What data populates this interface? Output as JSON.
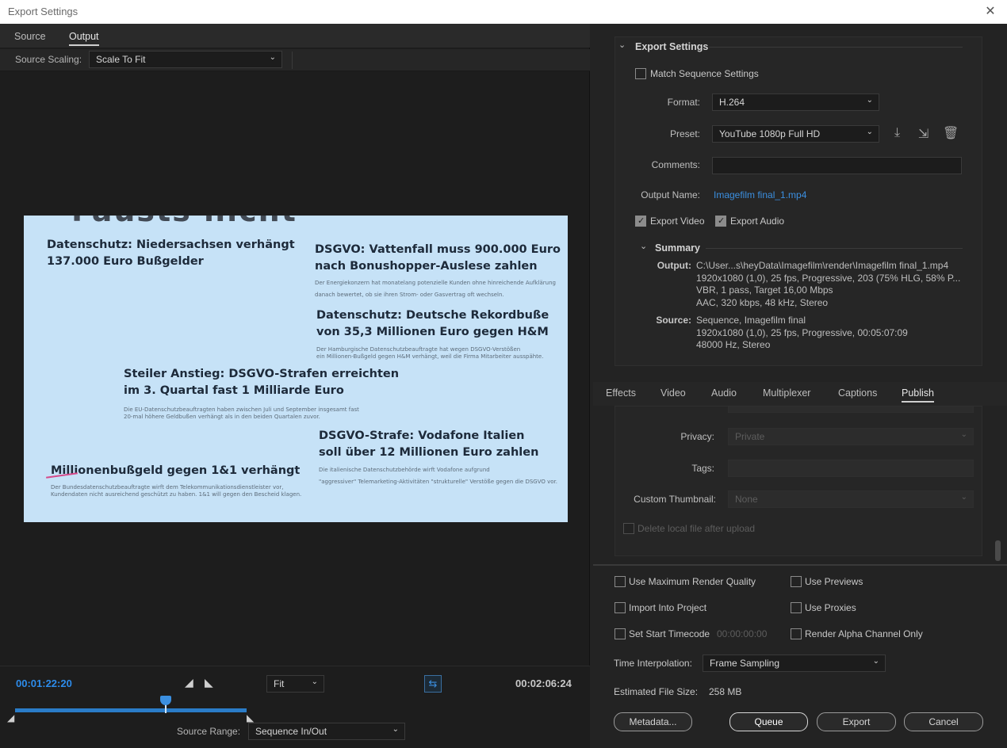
{
  "window": {
    "title": "Export Settings",
    "close_glyph": "✕"
  },
  "left": {
    "tabs": [
      "Source",
      "Output"
    ],
    "active_tab": "Output",
    "source_scaling_label": "Source Scaling:",
    "source_scaling_value": "Scale To Fit",
    "preview": {
      "faint_top_text": "Fausts nicht",
      "articles": [
        {
          "headline_1": "Datenschutz: Niedersachsen verhängt",
          "headline_2": "137.000 Euro Bußgelder",
          "body_1": "",
          "body_2": ""
        },
        {
          "headline_1": "DSGVO: Vattenfall muss 900.000 Euro",
          "headline_2": "nach Bonushopper-Auslese zahlen",
          "body_1": "Der Energiekonzern hat monatelang potenzielle Kunden ohne hinreichende Aufklärung",
          "body_2": "danach bewertet, ob sie ihren Strom- oder Gasvertrag oft wechseln."
        },
        {
          "headline_1": "Datenschutz: Deutsche Rekordbuße",
          "headline_2": "von 35,3 Millionen Euro gegen H&M",
          "body_1": "Der Hamburgische Datenschutzbeauftragte hat wegen DSGVO-Verstößen",
          "body_2": "ein Millionen-Bußgeld gegen H&M verhängt, weil die Firma Mitarbeiter ausspähte."
        },
        {
          "headline_1": "Steiler Anstieg: DSGVO-Strafen erreichten",
          "headline_2": "im 3. Quartal fast 1 Milliarde Euro",
          "body_1": "Die EU-Datenschutzbeauftragten haben zwischen Juli und September insgesamt fast",
          "body_2": "20-mal höhere Geldbußen verhängt als in den beiden Quartalen zuvor."
        },
        {
          "headline_1": "DSGVO-Strafe: Vodafone Italien",
          "headline_2": "soll über 12 Millionen Euro zahlen",
          "body_1": "Die italienische Datenschutzbehörde wirft Vodafone aufgrund",
          "body_2": "\"aggressiver\" Telemarketing-Aktivitäten \"strukturelle\" Verstöße gegen die DSGVO vor."
        },
        {
          "headline_1": "Millionenbußgeld gegen 1&1 verhängt",
          "headline_2": "",
          "body_1": "Der Bundesdatenschutzbeauftragte wirft dem Telekommunikationsdienstleister vor,",
          "body_2": "Kundendaten nicht ausreichend geschützt zu haben. 1&1 will gegen den Bescheid klagen."
        }
      ]
    },
    "timecode_current": "00:01:22:20",
    "timecode_duration": "00:02:06:24",
    "zoom_value": "Fit",
    "playhead_fraction": 0.3,
    "source_range_label": "Source Range:",
    "source_range_value": "Sequence In/Out"
  },
  "right": {
    "export_settings_header": "Export Settings",
    "match_sequence_label": "Match Sequence Settings",
    "match_sequence_checked": false,
    "format_label": "Format:",
    "format_value": "H.264",
    "preset_label": "Preset:",
    "preset_value": "YouTube 1080p Full HD",
    "comments_label": "Comments:",
    "comments_value": "",
    "output_name_label": "Output Name:",
    "output_name_value": "Imagefilm final_1.mp4",
    "export_video_label": "Export Video",
    "export_video_checked": true,
    "export_audio_label": "Export Audio",
    "export_audio_checked": true,
    "summary_header": "Summary",
    "summary_output_label": "Output:",
    "summary_output_lines": [
      "C:\\User...s\\heyData\\Imagefilm\\render\\Imagefilm final_1.mp4",
      "1920x1080 (1,0), 25 fps, Progressive, 203 (75% HLG, 58% P...",
      "VBR, 1 pass, Target 16,00 Mbps",
      "AAC, 320 kbps, 48 kHz, Stereo"
    ],
    "summary_source_label": "Source:",
    "summary_source_lines": [
      "Sequence, Imagefilm final",
      "1920x1080 (1,0), 25 fps, Progressive, 00:05:07:09",
      "48000 Hz, Stereo"
    ],
    "tabs": [
      "Effects",
      "Video",
      "Audio",
      "Multiplexer",
      "Captions",
      "Publish"
    ],
    "active_tab": "Publish",
    "privacy_label": "Privacy:",
    "privacy_value": "Private",
    "tags_label": "Tags:",
    "tags_value": "",
    "thumbnail_label": "Custom Thumbnail:",
    "thumbnail_value": "None",
    "delete_local_label": "Delete local file after upload",
    "max_render_label": "Use Maximum Render Quality",
    "use_previews_label": "Use Previews",
    "import_project_label": "Import Into Project",
    "use_proxies_label": "Use Proxies",
    "start_timecode_label": "Set Start Timecode",
    "start_timecode_value": "00:00:00:00",
    "render_alpha_label": "Render Alpha Channel Only",
    "time_interp_label": "Time Interpolation:",
    "time_interp_value": "Frame Sampling",
    "file_size_label": "Estimated File Size:",
    "file_size_value": "258 MB",
    "buttons": {
      "metadata": "Metadata...",
      "queue": "Queue",
      "export": "Export",
      "cancel": "Cancel"
    }
  }
}
